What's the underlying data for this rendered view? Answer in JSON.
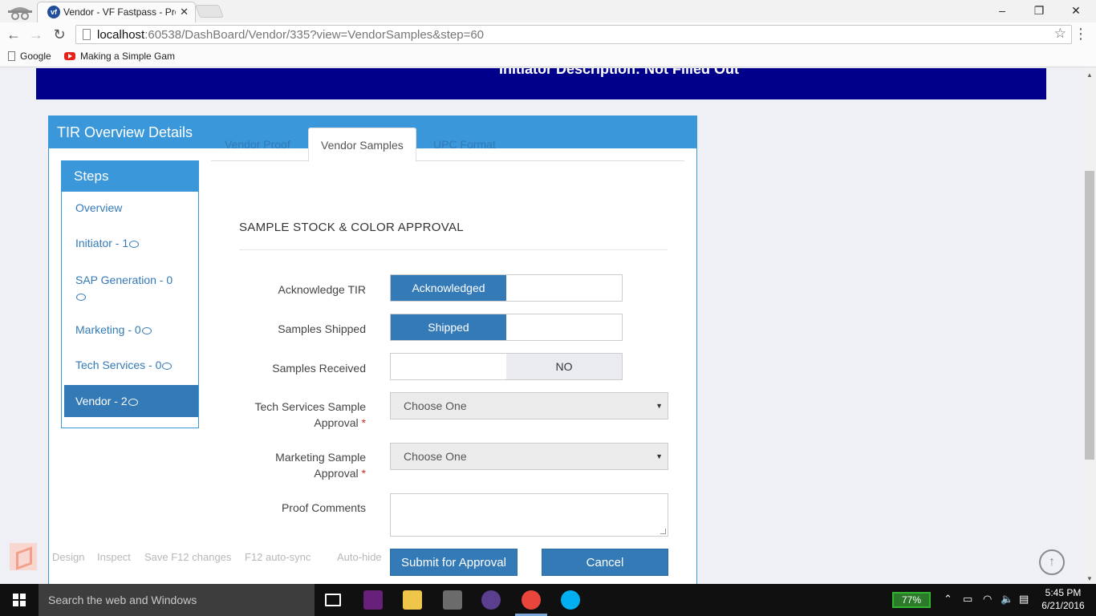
{
  "browser": {
    "tab_title": "Vendor - VF Fastpass - Pro",
    "tab_favicon": "vf",
    "url_host": "localhost",
    "url_rest": ":60538/DashBoard/Vendor/335?view=VendorSamples&step=60",
    "bookmarks": [
      "Google",
      "Making a Simple Gam"
    ],
    "window_controls": [
      "–",
      "❐",
      "✕"
    ]
  },
  "banner": {
    "text": "Initiator Description: Not Filled Out"
  },
  "panel": {
    "title": "TIR Overview Details",
    "steps_title": "Steps",
    "steps": [
      {
        "label": "Overview"
      },
      {
        "label": "Initiator - 1"
      },
      {
        "label": "SAP Generation - 0"
      },
      {
        "label": "Marketing - 0"
      },
      {
        "label": "Tech Services - 0"
      },
      {
        "label": "Vendor - 2"
      }
    ],
    "tabs": [
      "Vendor Proof",
      "Vendor Samples",
      "UPC Format"
    ],
    "active_tab": "Vendor Samples",
    "section_title": "SAMPLE STOCK & COLOR APPROVAL",
    "fields": {
      "acknowledge": {
        "label": "Acknowledge TIR",
        "on_label": "Acknowledged"
      },
      "shipped": {
        "label": "Samples Shipped",
        "on_label": "Shipped"
      },
      "received": {
        "label": "Samples Received",
        "off_label": "NO"
      },
      "tech_approval": {
        "label_line1": "Tech Services Sample",
        "label_line2": "Approval",
        "required": "*",
        "value": "Choose One"
      },
      "mkt_approval": {
        "label_line1": "Marketing Sample",
        "label_line2": "Approval",
        "required": "*",
        "value": "Choose One"
      },
      "comments": {
        "label": "Proof Comments",
        "value": ""
      }
    },
    "buttons": {
      "submit": "Submit for Approval",
      "cancel": "Cancel"
    }
  },
  "vs_browser_link": {
    "items": [
      "Design",
      "Inspect",
      "Save F12 changes",
      "F12 auto-sync",
      "Auto-hide"
    ]
  },
  "taskbar": {
    "search_placeholder": "Search the web and Windows",
    "battery": "77%",
    "time": "5:45 PM",
    "date": "6/21/2016"
  },
  "colors": {
    "accent": "#3a97d9",
    "primary_button": "#337ab7",
    "banner": "#00008b",
    "required": "#c9302c"
  }
}
